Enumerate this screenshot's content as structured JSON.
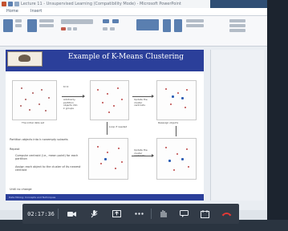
{
  "app": {
    "window_title": "Lecture 11 - Unsupervised Learning (Compatibility Mode) - Microsoft PowerPoint",
    "menu": {
      "home": "Home",
      "insert": "Insert"
    }
  },
  "slide": {
    "title": "Example of K-Means Clustering",
    "labels": {
      "first_panel": "The initial data set",
      "k2": "K=2",
      "step1": "Arbitrarily partition objects into k groups",
      "update": "Update the cluster centroids",
      "update2": "Update the cluster centroids",
      "loop": "Loop if needed",
      "reassign": "Reassign objects"
    },
    "bullets": [
      "Partition objects into k nonempty subsets",
      "Repeat",
      "Compute centroid (i.e., mean point) for each partition",
      "Assign each object to the cluster of its nearest centroid",
      "Until no change"
    ],
    "footer": "Data Mining: Concepts and Techniques"
  },
  "call_toolbar": {
    "timer": "02:17:36",
    "colors": {
      "bar": "#323b47",
      "hangup": "#e53935",
      "icon": "#e8ecf1"
    },
    "icons": [
      "video-icon",
      "hand-icon",
      "share-icon",
      "more-icon",
      "raise-hand-icon",
      "chat-icon",
      "participants-icon",
      "hangup-icon"
    ]
  }
}
